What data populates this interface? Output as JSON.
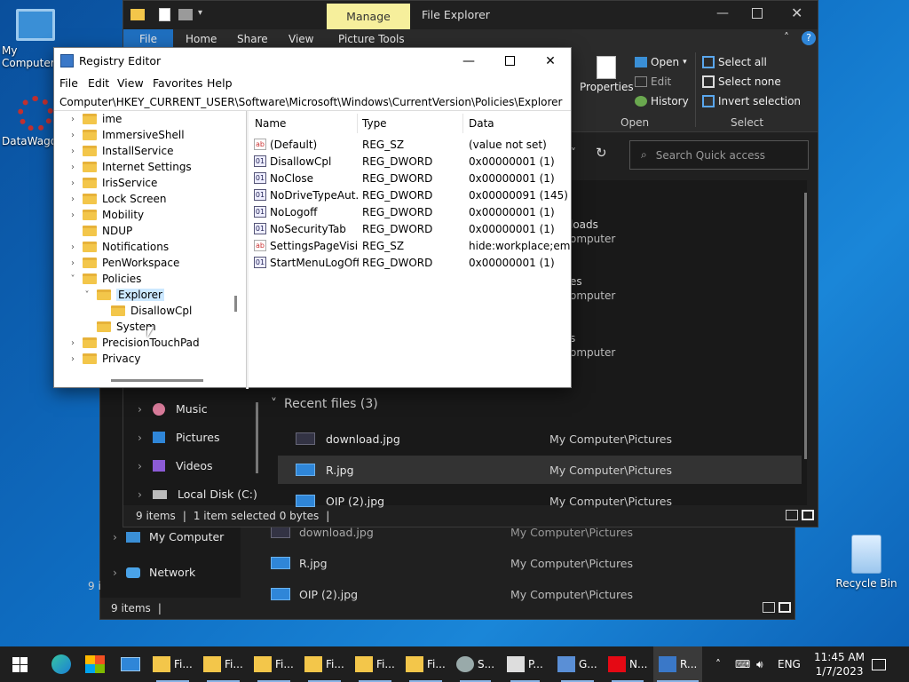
{
  "desktop": {
    "icons": [
      "My Computer",
      "DataWagon",
      "Recycle Bin"
    ]
  },
  "explorer_back": {
    "nav": [
      "My Computer",
      "Network"
    ],
    "rows": [
      {
        "name": "download.jpg",
        "location": "My Computer\\Pictures"
      },
      {
        "name": "R.jpg",
        "location": "My Computer\\Pictures"
      },
      {
        "name": "OIP (2).jpg",
        "location": "My Computer\\Pictures"
      }
    ],
    "status": "9 items",
    "side_fragment": "9 i"
  },
  "explorer": {
    "manage_label": "Manage",
    "title": "File Explorer",
    "tabs": {
      "file": "File",
      "home": "Home",
      "share": "Share",
      "view": "View",
      "picture_tools": "Picture Tools"
    },
    "ribbon": {
      "properties": "Properties",
      "open": "Open",
      "edit": "Edit",
      "history": "History",
      "select_all": "Select all",
      "select_none": "Select none",
      "invert_selection": "Invert selection",
      "group_open": "Open",
      "group_select": "Select"
    },
    "search_placeholder": "Search Quick access",
    "partial_texts": [
      "loads",
      "omputer",
      "es",
      "omputer",
      "s",
      "omputer"
    ],
    "nav": [
      "Music",
      "Pictures",
      "Videos",
      "Local Disk (C:)"
    ],
    "recent_header": "Recent files (3)",
    "recent": [
      {
        "name": "download.jpg",
        "location": "My Computer\\Pictures"
      },
      {
        "name": "R.jpg",
        "location": "My Computer\\Pictures"
      },
      {
        "name": "OIP (2).jpg",
        "location": "My Computer\\Pictures"
      }
    ],
    "status": {
      "items": "9 items",
      "selected": "1 item selected  0 bytes"
    }
  },
  "regedit": {
    "title": "Registry Editor",
    "menu": [
      "File",
      "Edit",
      "View",
      "Favorites",
      "Help"
    ],
    "path": "Computer\\HKEY_CURRENT_USER\\Software\\Microsoft\\Windows\\CurrentVersion\\Policies\\Explorer",
    "tree": [
      {
        "label": "ime",
        "depth": 0,
        "chev": ">"
      },
      {
        "label": "ImmersiveShell",
        "depth": 0,
        "chev": ">"
      },
      {
        "label": "InstallService",
        "depth": 0,
        "chev": ">"
      },
      {
        "label": "Internet Settings",
        "depth": 0,
        "chev": ">"
      },
      {
        "label": "IrisService",
        "depth": 0,
        "chev": ">"
      },
      {
        "label": "Lock Screen",
        "depth": 0,
        "chev": ">"
      },
      {
        "label": "Mobility",
        "depth": 0,
        "chev": ">"
      },
      {
        "label": "NDUP",
        "depth": 0,
        "chev": ""
      },
      {
        "label": "Notifications",
        "depth": 0,
        "chev": ">"
      },
      {
        "label": "PenWorkspace",
        "depth": 0,
        "chev": ">"
      },
      {
        "label": "Policies",
        "depth": 0,
        "chev": "v"
      },
      {
        "label": "Explorer",
        "depth": 1,
        "chev": "v",
        "selected": true
      },
      {
        "label": "DisallowCpl",
        "depth": 2,
        "chev": ""
      },
      {
        "label": "System",
        "depth": 1,
        "chev": ""
      },
      {
        "label": "PrecisionTouchPad",
        "depth": 0,
        "chev": ">"
      },
      {
        "label": "Privacy",
        "depth": 0,
        "chev": ">"
      }
    ],
    "columns": {
      "name": "Name",
      "type": "Type",
      "data": "Data"
    },
    "values": [
      {
        "name": "(Default)",
        "type": "REG_SZ",
        "data": "(value not set)",
        "kind": "sz"
      },
      {
        "name": "DisallowCpl",
        "type": "REG_DWORD",
        "data": "0x00000001 (1)",
        "kind": "dword"
      },
      {
        "name": "NoClose",
        "type": "REG_DWORD",
        "data": "0x00000001 (1)",
        "kind": "dword"
      },
      {
        "name": "NoDriveTypeAut...",
        "type": "REG_DWORD",
        "data": "0x00000091 (145)",
        "kind": "dword"
      },
      {
        "name": "NoLogoff",
        "type": "REG_DWORD",
        "data": "0x00000001 (1)",
        "kind": "dword"
      },
      {
        "name": "NoSecurityTab",
        "type": "REG_DWORD",
        "data": "0x00000001 (1)",
        "kind": "dword"
      },
      {
        "name": "SettingsPageVisi...",
        "type": "REG_SZ",
        "data": "hide:workplace;email",
        "kind": "sz"
      },
      {
        "name": "StartMenuLogOff",
        "type": "REG_DWORD",
        "data": "0x00000001 (1)",
        "kind": "dword"
      }
    ]
  },
  "taskbar": {
    "items": [
      {
        "label": "Fi...",
        "icon": "folder-icon"
      },
      {
        "label": "Fi...",
        "icon": "folder-icon"
      },
      {
        "label": "Fi...",
        "icon": "folder-icon"
      },
      {
        "label": "Fi...",
        "icon": "folder-icon"
      },
      {
        "label": "Fi...",
        "icon": "folder-icon"
      },
      {
        "label": "Fi...",
        "icon": "folder-icon"
      },
      {
        "label": "S...",
        "icon": "settings-icon"
      },
      {
        "label": "P...",
        "icon": "document-icon"
      },
      {
        "label": "G...",
        "icon": "drive-icon"
      },
      {
        "label": "N...",
        "icon": "netflix-icon"
      },
      {
        "label": "R...",
        "icon": "regedit-icon"
      }
    ],
    "lang": "ENG",
    "time": "11:45 AM",
    "date": "1/7/2023"
  }
}
